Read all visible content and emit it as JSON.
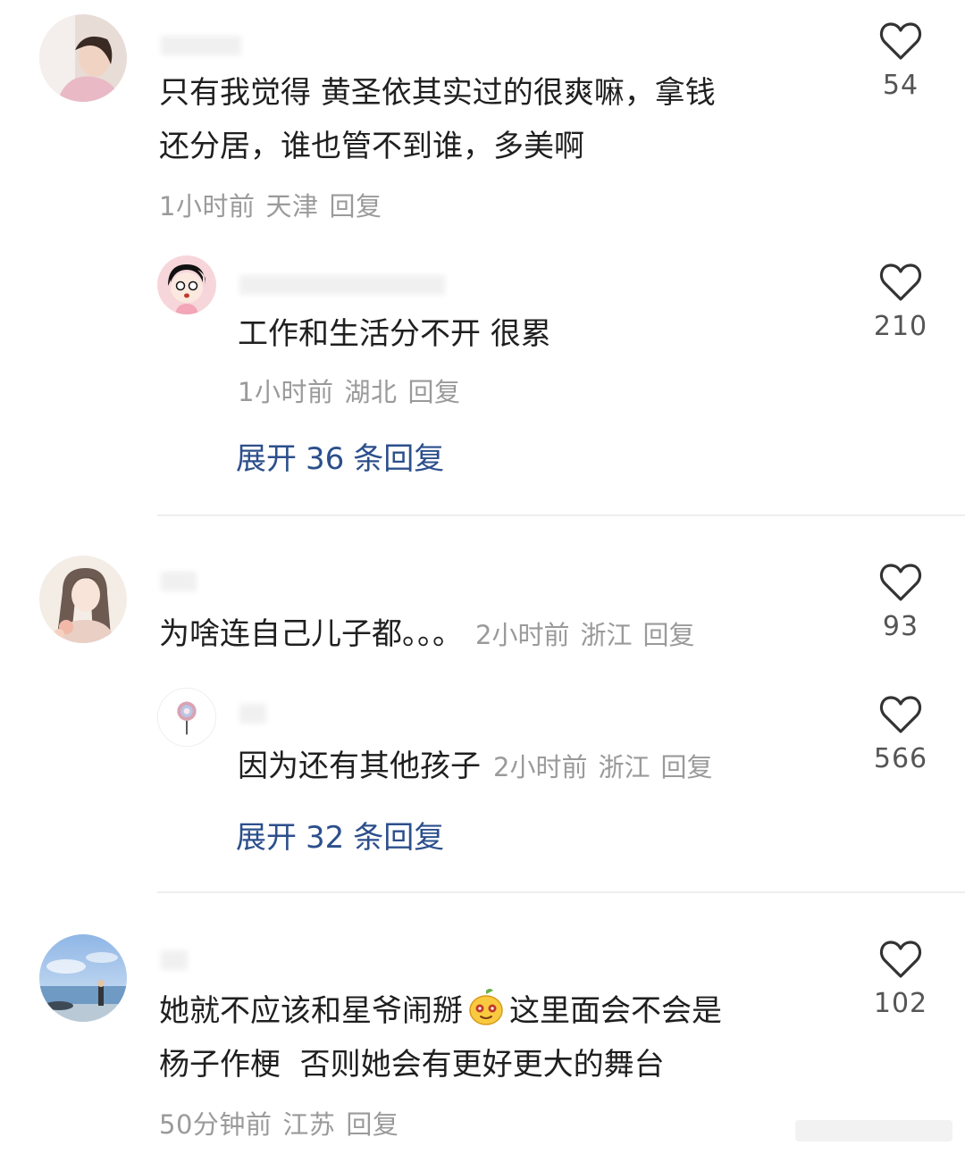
{
  "comments": [
    {
      "text_lines": [
        "只有我觉得 黄圣依其实过的很爽嘛，拿钱",
        "还分居，谁也管不到谁，多美啊"
      ],
      "time": "1小时前",
      "location": "天津",
      "reply_label": "回复",
      "likes": "54",
      "reply": {
        "text": "工作和生活分不开 很累",
        "time": "1小时前",
        "location": "湖北",
        "reply_label": "回复",
        "likes": "210"
      },
      "expand": {
        "prefix": "展开",
        "count": "36",
        "suffix": "条回复"
      }
    },
    {
      "text": "为啥连自己儿子都。。。",
      "time": "2小时前",
      "location": "浙江",
      "reply_label": "回复",
      "likes": "93",
      "reply": {
        "text": "因为还有其他孩子",
        "time": "2小时前",
        "location": "浙江",
        "reply_label": "回复",
        "likes": "566"
      },
      "expand": {
        "prefix": "展开",
        "count": "32",
        "suffix": "条回复"
      }
    },
    {
      "text_line1_a": "她就不应该和星爷闹掰",
      "text_line1_b": "这里面会不会是",
      "text_line2": "杨子作梗  否则她会有更好更大的舞台",
      "time": "50分钟前",
      "location": "江苏",
      "reply_label": "回复",
      "likes": "102"
    }
  ],
  "icons": {
    "like": "heart-outline-icon",
    "emoji": "fruit-face-emoji-icon"
  },
  "colors": {
    "expand_link": "#2c4f8c",
    "meta": "#9a9a9a",
    "text": "#1f1f1f"
  }
}
